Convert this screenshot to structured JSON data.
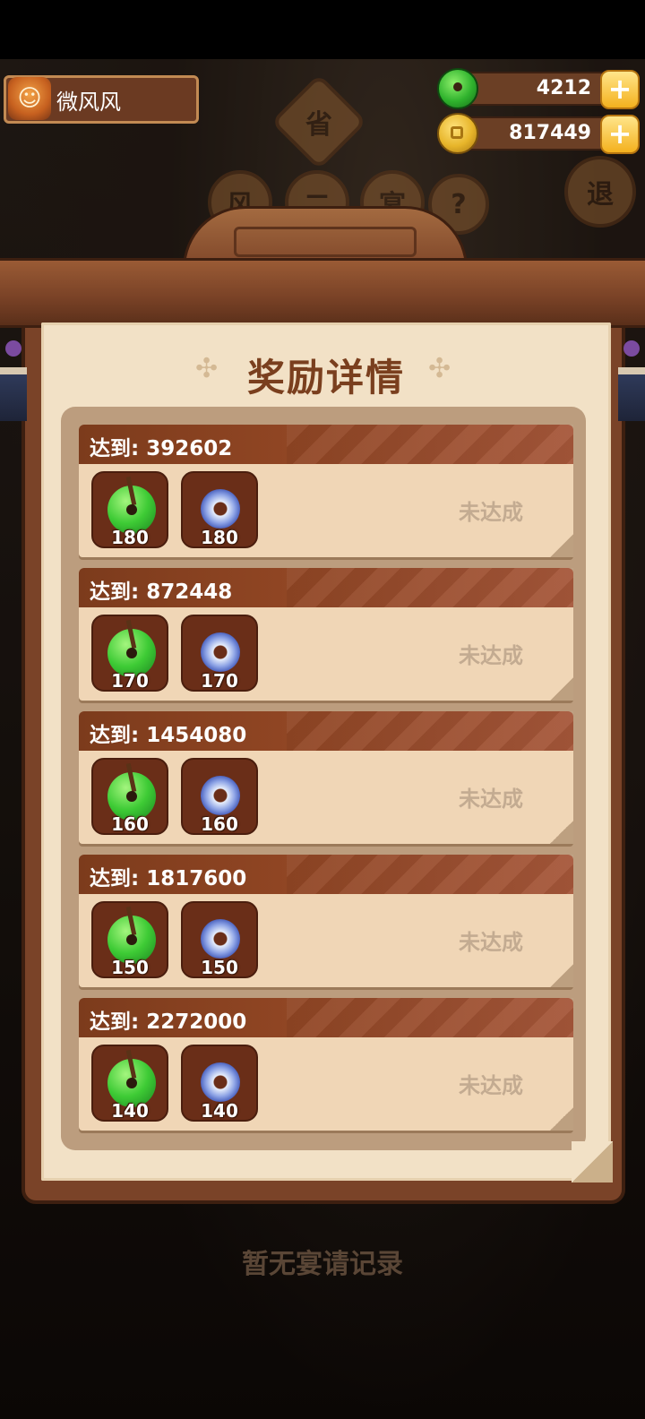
{
  "player": {
    "name": "微风风"
  },
  "currencies": {
    "jade": {
      "value": "4212",
      "icon": "jade-icon"
    },
    "coin": {
      "value": "817449",
      "icon": "coin-icon"
    },
    "add_label": "+"
  },
  "background": {
    "top_button": "省",
    "round_buttons": [
      "风",
      "二",
      "宴",
      "?"
    ],
    "exit_button": "退",
    "empty_text": "暂无宴请记录"
  },
  "dialog": {
    "title": "奖励详情",
    "rows": [
      {
        "label": "达到: 392602",
        "rewards": [
          {
            "icon": "jade-icon",
            "qty": "180"
          },
          {
            "icon": "disc-icon",
            "qty": "180"
          }
        ],
        "status": "未达成"
      },
      {
        "label": "达到: 872448",
        "rewards": [
          {
            "icon": "jade-icon",
            "qty": "170"
          },
          {
            "icon": "disc-icon",
            "qty": "170"
          }
        ],
        "status": "未达成"
      },
      {
        "label": "达到: 1454080",
        "rewards": [
          {
            "icon": "jade-icon",
            "qty": "160"
          },
          {
            "icon": "disc-icon",
            "qty": "160"
          }
        ],
        "status": "未达成"
      },
      {
        "label": "达到: 1817600",
        "rewards": [
          {
            "icon": "jade-icon",
            "qty": "150"
          },
          {
            "icon": "disc-icon",
            "qty": "150"
          }
        ],
        "status": "未达成"
      },
      {
        "label": "达到: 2272000",
        "rewards": [
          {
            "icon": "jade-icon",
            "qty": "140"
          },
          {
            "icon": "disc-icon",
            "qty": "140"
          }
        ],
        "status": "未达成"
      }
    ]
  },
  "colors": {
    "header": "#8f4523",
    "paper": "#f2e1c6",
    "status_text": "#c3ab91"
  }
}
